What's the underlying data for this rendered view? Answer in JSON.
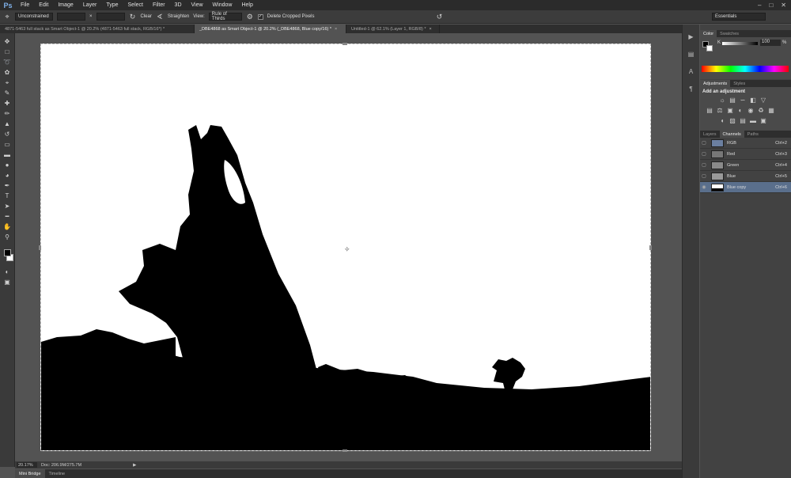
{
  "app": {
    "logo": "Ps"
  },
  "menu": [
    "File",
    "Edit",
    "Image",
    "Layer",
    "Type",
    "Select",
    "Filter",
    "3D",
    "View",
    "Window",
    "Help"
  ],
  "window_controls": {
    "minimize": "–",
    "restore": "□",
    "close": "✕"
  },
  "options_bar": {
    "ratio": "Unconstrained",
    "swap_symbol": "×",
    "clear_label": "Clear",
    "straighten_label": "Straighten",
    "view_label": "View:",
    "view_value": "Rule of Thirds",
    "delete_cropped_label": "Delete Cropped Pixels",
    "workspace": "Essentials"
  },
  "doc_tabs": [
    {
      "label": "4871-5463 full stack as Smart Object-1 @ 20.2% (4871-5463 full stack, RGB/16*) *",
      "active": false
    },
    {
      "label": "_DBE4868 as Smart Object-1 @ 20.2% (_DBE4868, Blue copy/16) *",
      "active": true
    },
    {
      "label": "Untitled-1 @ 62.1% (Layer 1, RGB/8) *",
      "active": false
    }
  ],
  "tools": [
    "move-icon",
    "marquee-icon",
    "lasso-icon",
    "quick-select-icon",
    "crop-icon",
    "eyedropper-icon",
    "healing-icon",
    "brush-icon",
    "stamp-icon",
    "history-brush-icon",
    "eraser-icon",
    "gradient-icon",
    "blur-icon",
    "dodge-icon",
    "pen-icon",
    "type-icon",
    "path-select-icon",
    "shape-icon",
    "hand-icon",
    "zoom-icon"
  ],
  "status": {
    "zoom": "20.17%",
    "doc": "Doc: 206.9M/275.7M"
  },
  "bottom_tabs": [
    "Mini Bridge",
    "Timeline"
  ],
  "color_panel": {
    "tabs": [
      "Color",
      "Swatches"
    ],
    "channel_label": "K",
    "value": "100",
    "pct": "%"
  },
  "adjustments_panel": {
    "tabs": [
      "Adjustments",
      "Styles"
    ],
    "title": "Add an adjustment"
  },
  "channels_panel": {
    "tabs": [
      "Layers",
      "Channels",
      "Paths"
    ],
    "rows": [
      {
        "name": "RGB",
        "key": "Ctrl+2",
        "selected": false
      },
      {
        "name": "Red",
        "key": "Ctrl+3",
        "selected": false
      },
      {
        "name": "Green",
        "key": "Ctrl+4",
        "selected": false
      },
      {
        "name": "Blue",
        "key": "Ctrl+5",
        "selected": false
      },
      {
        "name": "Blue copy",
        "key": "Ctrl+6",
        "selected": true
      }
    ]
  },
  "colors": {
    "accent_selected": "#5a6f8c",
    "ui_dark": "#535353"
  }
}
